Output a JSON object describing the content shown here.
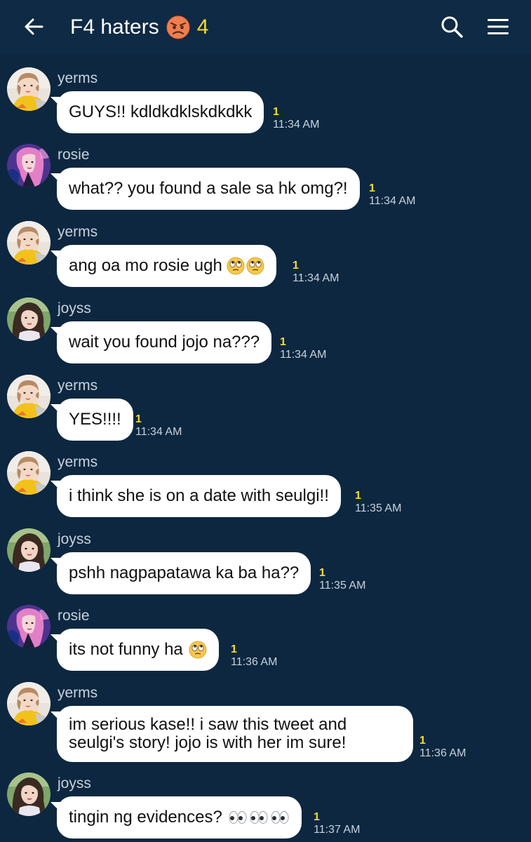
{
  "header": {
    "title": "F4 haters",
    "title_emoji": "angry-face-emoji",
    "member_count": "4",
    "back_icon": "arrow-left-icon",
    "search_icon": "search-icon",
    "menu_icon": "menu-icon"
  },
  "colors": {
    "background": "#0d2740",
    "bubble": "#ffffff",
    "read_count": "#f7dc2c",
    "sender": "#c7d2dc"
  },
  "messages": [
    {
      "sender": "yerms",
      "text": "GUYS!! kdldkdklskdkdkk",
      "read": "1",
      "time": "11:34 AM"
    },
    {
      "sender": "rosie",
      "text": "what?? you found a sale sa hk omg?!",
      "read": "1",
      "time": "11:34 AM"
    },
    {
      "sender": "yerms",
      "text": "ang oa mo rosie ugh",
      "emoji": "face-with-rolling-eyes-emoji x2",
      "read": "1",
      "time": "11:34 AM"
    },
    {
      "sender": "joyss",
      "text": "wait you found jojo na???",
      "read": "1",
      "time": "11:34 AM"
    },
    {
      "sender": "yerms",
      "text": "YES!!!!",
      "read": "1",
      "time": "11:34 AM"
    },
    {
      "sender": "yerms",
      "text": "i think she is on a date with seulgi!!",
      "read": "1",
      "time": "11:35 AM"
    },
    {
      "sender": "joyss",
      "text": "pshh nagpapatawa ka ba ha??",
      "read": "1",
      "time": "11:35 AM"
    },
    {
      "sender": "rosie",
      "text": "its not funny ha",
      "emoji": "face-with-rolling-eyes-emoji",
      "read": "1",
      "time": "11:36 AM"
    },
    {
      "sender": "yerms",
      "text_line1": "im serious kase!! i saw this tweet and",
      "text_line2": "seulgi's story! jojo is with her im sure!",
      "read": "1",
      "time": "11:36 AM"
    },
    {
      "sender": "joyss",
      "text": "tingin ng evidences?",
      "emoji": "eyes-emoji x3",
      "read": "1",
      "time": "11:37 AM"
    }
  ]
}
